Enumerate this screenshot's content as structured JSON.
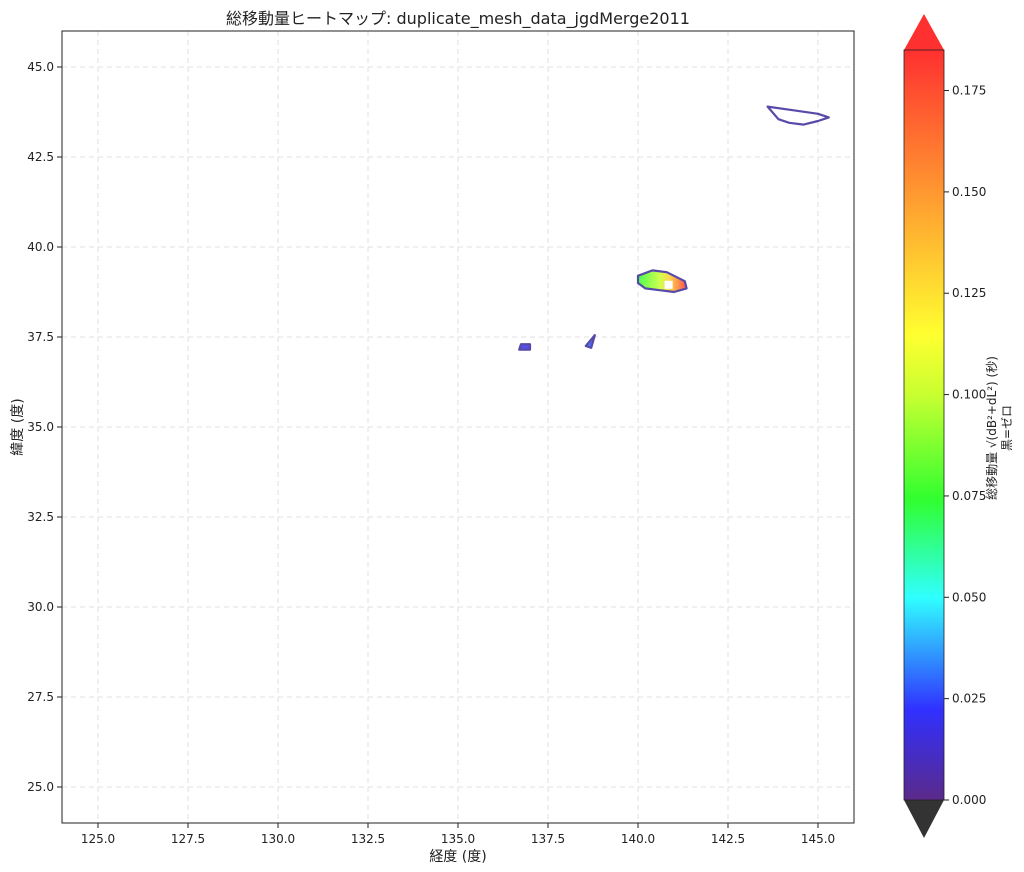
{
  "chart_data": {
    "type": "heatmap",
    "title": "総移動量ヒートマップ: duplicate_mesh_data_jgdMerge2011",
    "xlabel": "経度 (度)",
    "ylabel": "緯度 (度)",
    "xlim": [
      124.0,
      146.0
    ],
    "ylim": [
      24.0,
      46.0
    ],
    "x_ticks": [
      125.0,
      127.5,
      130.0,
      132.5,
      135.0,
      137.5,
      140.0,
      142.5,
      145.0
    ],
    "y_ticks": [
      25.0,
      27.5,
      30.0,
      32.5,
      35.0,
      37.5,
      40.0,
      42.5,
      45.0
    ],
    "x_tick_labels": [
      "125.0",
      "127.5",
      "130.0",
      "132.5",
      "135.0",
      "137.5",
      "140.0",
      "142.5",
      "145.0"
    ],
    "y_tick_labels": [
      "25.0",
      "27.5",
      "30.0",
      "32.5",
      "35.0",
      "37.5",
      "40.0",
      "42.5",
      "45.0"
    ],
    "grid": true,
    "colorbar": {
      "label_line1": "総移動量 √(dB²+dL²) (秒)",
      "label_line2": "黒=ゼロ",
      "min": 0.0,
      "max": 0.185,
      "ticks": [
        0.0,
        0.025,
        0.05,
        0.075,
        0.1,
        0.125,
        0.15,
        0.175
      ],
      "tick_labels": [
        "0.000",
        "0.025",
        "0.050",
        "0.075",
        "0.100",
        "0.125",
        "0.150",
        "0.175"
      ],
      "extend": "both",
      "under_color": "#333333",
      "over_color": "#ff3030"
    },
    "regions": [
      {
        "name": "hokkaido-east",
        "outline": [
          [
            143.6,
            43.9
          ],
          [
            144.3,
            43.8
          ],
          [
            145.0,
            43.7
          ],
          [
            145.3,
            43.6
          ],
          [
            145.0,
            43.5
          ],
          [
            144.6,
            43.4
          ],
          [
            144.2,
            43.45
          ],
          [
            143.9,
            43.55
          ],
          [
            143.6,
            43.9
          ]
        ],
        "value": 0.005,
        "gradient": false
      },
      {
        "name": "tohoku-coast",
        "outline": [
          [
            140.0,
            39.2
          ],
          [
            140.4,
            39.35
          ],
          [
            140.8,
            39.3
          ],
          [
            141.3,
            39.05
          ],
          [
            141.35,
            38.85
          ],
          [
            141.0,
            38.75
          ],
          [
            140.6,
            38.8
          ],
          [
            140.2,
            38.85
          ],
          [
            140.0,
            39.0
          ],
          [
            140.0,
            39.2
          ]
        ],
        "value": 0.1,
        "gradient": true,
        "gradient_values": [
          0.07,
          0.1,
          0.13,
          0.17
        ]
      },
      {
        "name": "niigata",
        "outline": [
          [
            138.55,
            37.25
          ],
          [
            138.8,
            37.55
          ],
          [
            138.7,
            37.2
          ],
          [
            138.55,
            37.25
          ]
        ],
        "value": 0.028,
        "gradient": false
      },
      {
        "name": "noto",
        "outline": [
          [
            136.7,
            37.15
          ],
          [
            137.0,
            37.15
          ],
          [
            137.0,
            37.3
          ],
          [
            136.75,
            37.3
          ],
          [
            136.7,
            37.15
          ]
        ],
        "value": 0.018,
        "gradient": false
      }
    ],
    "highlight_cell": {
      "x": 140.85,
      "y": 38.95
    }
  }
}
